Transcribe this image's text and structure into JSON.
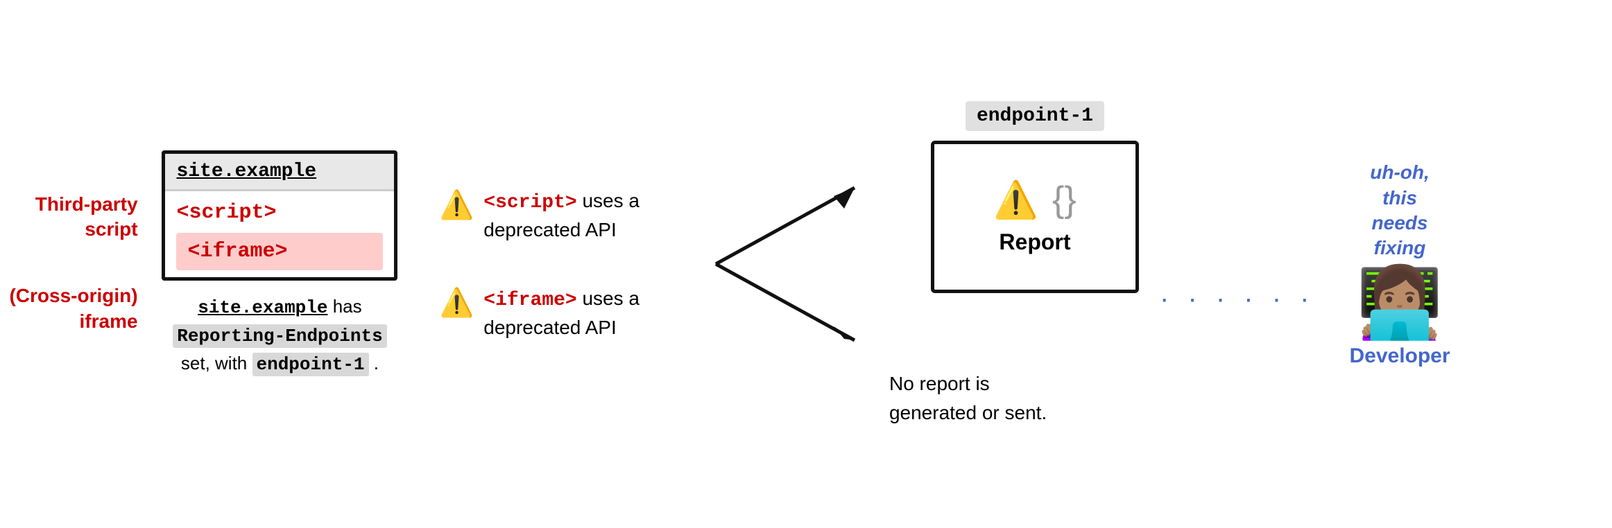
{
  "site": {
    "title": "site.example",
    "script_tag": "<script>",
    "iframe_tag": "<iframe>",
    "caption_line1": "site.example",
    "caption_line2": " has",
    "caption_code1": "Reporting-Endpoints",
    "caption_line3": "set, with",
    "caption_code2": "endpoint-1",
    "caption_line4": "."
  },
  "side_labels": {
    "third_party": "Third-party\nscript",
    "cross_origin": "(Cross-origin)\niframe"
  },
  "warnings": [
    {
      "icon": "⚠️",
      "tag": "<script>",
      "text": " uses a\ndeprecated API"
    },
    {
      "icon": "⚠️",
      "tag": "<iframe>",
      "text": " uses a\ndeprecated API"
    }
  ],
  "endpoint": {
    "label": "endpoint-1",
    "report_label": "Report",
    "curly_braces": "{}"
  },
  "no_report": {
    "text": "No report is\ngenerated or sent."
  },
  "developer": {
    "speech": "uh-oh,\nthis\nneeds\nfixing",
    "label": "Developer"
  }
}
